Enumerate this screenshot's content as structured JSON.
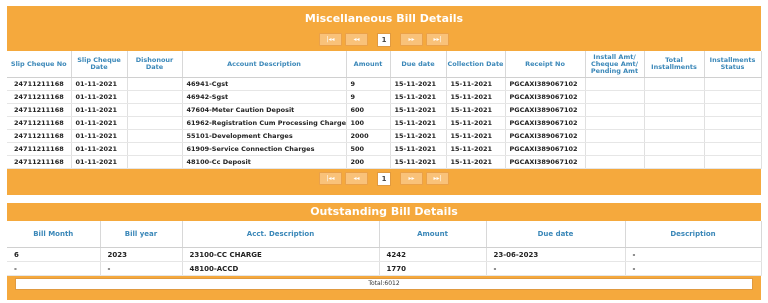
{
  "misc": {
    "title": "Miscellaneous Bill Details",
    "pager": {
      "first": "|◂◂",
      "prev": "◂◂",
      "page": "1",
      "next": "▸▸",
      "last": "▸▸|"
    },
    "headers": [
      "Slip Cheque No",
      "Slip Cheque Date",
      "Dishonour Date",
      "Account Description",
      "Amount",
      "Due date",
      "Collection Date",
      "Receipt No",
      "Install Amt/ Cheque Amt/ Pending Amt",
      "Total Installments",
      "Installments Status"
    ],
    "rows": [
      [
        "24711211168",
        "01-11-2021",
        "",
        "46941-Cgst",
        "9",
        "15-11-2021",
        "15-11-2021",
        "PGCAXI389067102",
        "",
        "",
        ""
      ],
      [
        "24711211168",
        "01-11-2021",
        "",
        "46942-Sgst",
        "9",
        "15-11-2021",
        "15-11-2021",
        "PGCAXI389067102",
        "",
        "",
        ""
      ],
      [
        "24711211168",
        "01-11-2021",
        "",
        "47604-Meter Caution Deposit",
        "600",
        "15-11-2021",
        "15-11-2021",
        "PGCAXI389067102",
        "",
        "",
        ""
      ],
      [
        "24711211168",
        "01-11-2021",
        "",
        "61962-Registration Cum Processing Charges",
        "100",
        "15-11-2021",
        "15-11-2021",
        "PGCAXI389067102",
        "",
        "",
        ""
      ],
      [
        "24711211168",
        "01-11-2021",
        "",
        "55101-Development Charges",
        "2000",
        "15-11-2021",
        "15-11-2021",
        "PGCAXI389067102",
        "",
        "",
        ""
      ],
      [
        "24711211168",
        "01-11-2021",
        "",
        "61909-Service Connection Charges",
        "500",
        "15-11-2021",
        "15-11-2021",
        "PGCAXI389067102",
        "",
        "",
        ""
      ],
      [
        "24711211168",
        "01-11-2021",
        "",
        "48100-Cc Deposit",
        "200",
        "15-11-2021",
        "15-11-2021",
        "PGCAXI389067102",
        "",
        "",
        ""
      ]
    ]
  },
  "outstanding": {
    "title": "Outstanding Bill Details",
    "headers": [
      "Bill Month",
      "Bill year",
      "Acct. Description",
      "Amount",
      "Due date",
      "Description"
    ],
    "rows": [
      [
        "6",
        "2023",
        "23100-CC CHARGE",
        "4242",
        "23-06-2023",
        "-"
      ],
      [
        "-",
        "-",
        "48100-ACCD",
        "1770",
        "-",
        "-"
      ]
    ],
    "total": "Total:6012"
  },
  "colors": {
    "panel": "#f5a93d",
    "header_text": "#3a87b8"
  }
}
